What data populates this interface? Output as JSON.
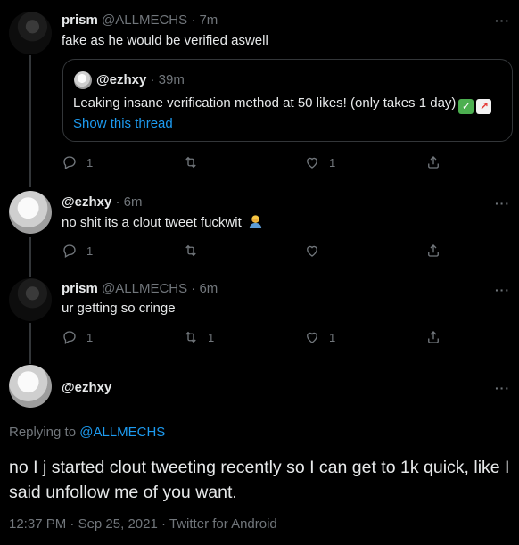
{
  "tweets": [
    {
      "name": "prism",
      "handle": "@ALLMECHS",
      "dot": "·",
      "time": "7m",
      "text": "fake as he would be verified aswell",
      "more": "···",
      "quote": {
        "handle": "@ezhxy",
        "dot": "·",
        "time": "39m",
        "text": "Leaking insane verification method at 50 likes! (only takes 1 day)",
        "emoji": [
          "check-mark-emoji",
          "chart-up-emoji"
        ],
        "link": "Show this thread"
      },
      "reply_count": "1",
      "retweet_count": "",
      "like_count": "1"
    },
    {
      "name": "@ezhxy",
      "dot": "·",
      "time": "6m",
      "text": "no shit its a clout tweet fuckwit",
      "emoji": "facepalm-emoji",
      "more": "···",
      "reply_count": "1",
      "retweet_count": "",
      "like_count": ""
    },
    {
      "name": "prism",
      "handle": "@ALLMECHS",
      "dot": "·",
      "time": "6m",
      "text": "ur getting so cringe",
      "more": "···",
      "reply_count": "1",
      "retweet_count": "1",
      "like_count": "1"
    }
  ],
  "main_tweet": {
    "name": "@ezhxy",
    "more": "···",
    "replying_prefix": "Replying to",
    "replying_to": "@ALLMECHS",
    "text": "no I j started clout tweeting recently so I can get to 1k quick, like I said unfollow me of you want.",
    "time": "12:37 PM",
    "dot": "·",
    "date": "Sep 25, 2021",
    "dot2": "·",
    "source": "Twitter for Android"
  },
  "icons": [
    "reply-icon",
    "retweet-icon",
    "like-icon",
    "share-icon",
    "more-icon"
  ],
  "colors": {
    "background": "#000000",
    "link": "#1d9bf0",
    "muted": "#71767b",
    "text": "#e7e9ea"
  }
}
